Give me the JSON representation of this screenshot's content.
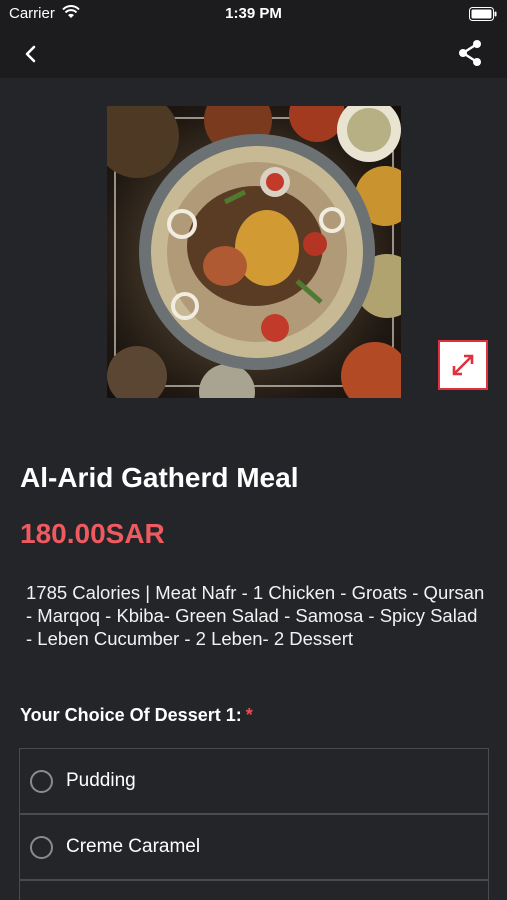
{
  "status_bar": {
    "carrier": "Carrier",
    "time": "1:39 PM"
  },
  "nav": {
    "back_icon": "chevron-left-icon",
    "share_icon": "share-icon"
  },
  "product": {
    "image_alt": "meal-photo",
    "name": "Al-Arid Gatherd Meal",
    "price": "180.00SAR",
    "description": "1785 Calories | Meat Nafr - 1 Chicken - Groats - Qursan - Marqoq - Kbiba- Green Salad - Samosa - Spicy Salad - Leben Cucumber - 2 Leben- 2 Dessert"
  },
  "choice_section": {
    "title": "Your Choice Of Dessert 1:",
    "required_marker": "*",
    "options": [
      {
        "label": "Pudding",
        "selected": false
      },
      {
        "label": "Creme Caramel",
        "selected": false
      }
    ]
  }
}
